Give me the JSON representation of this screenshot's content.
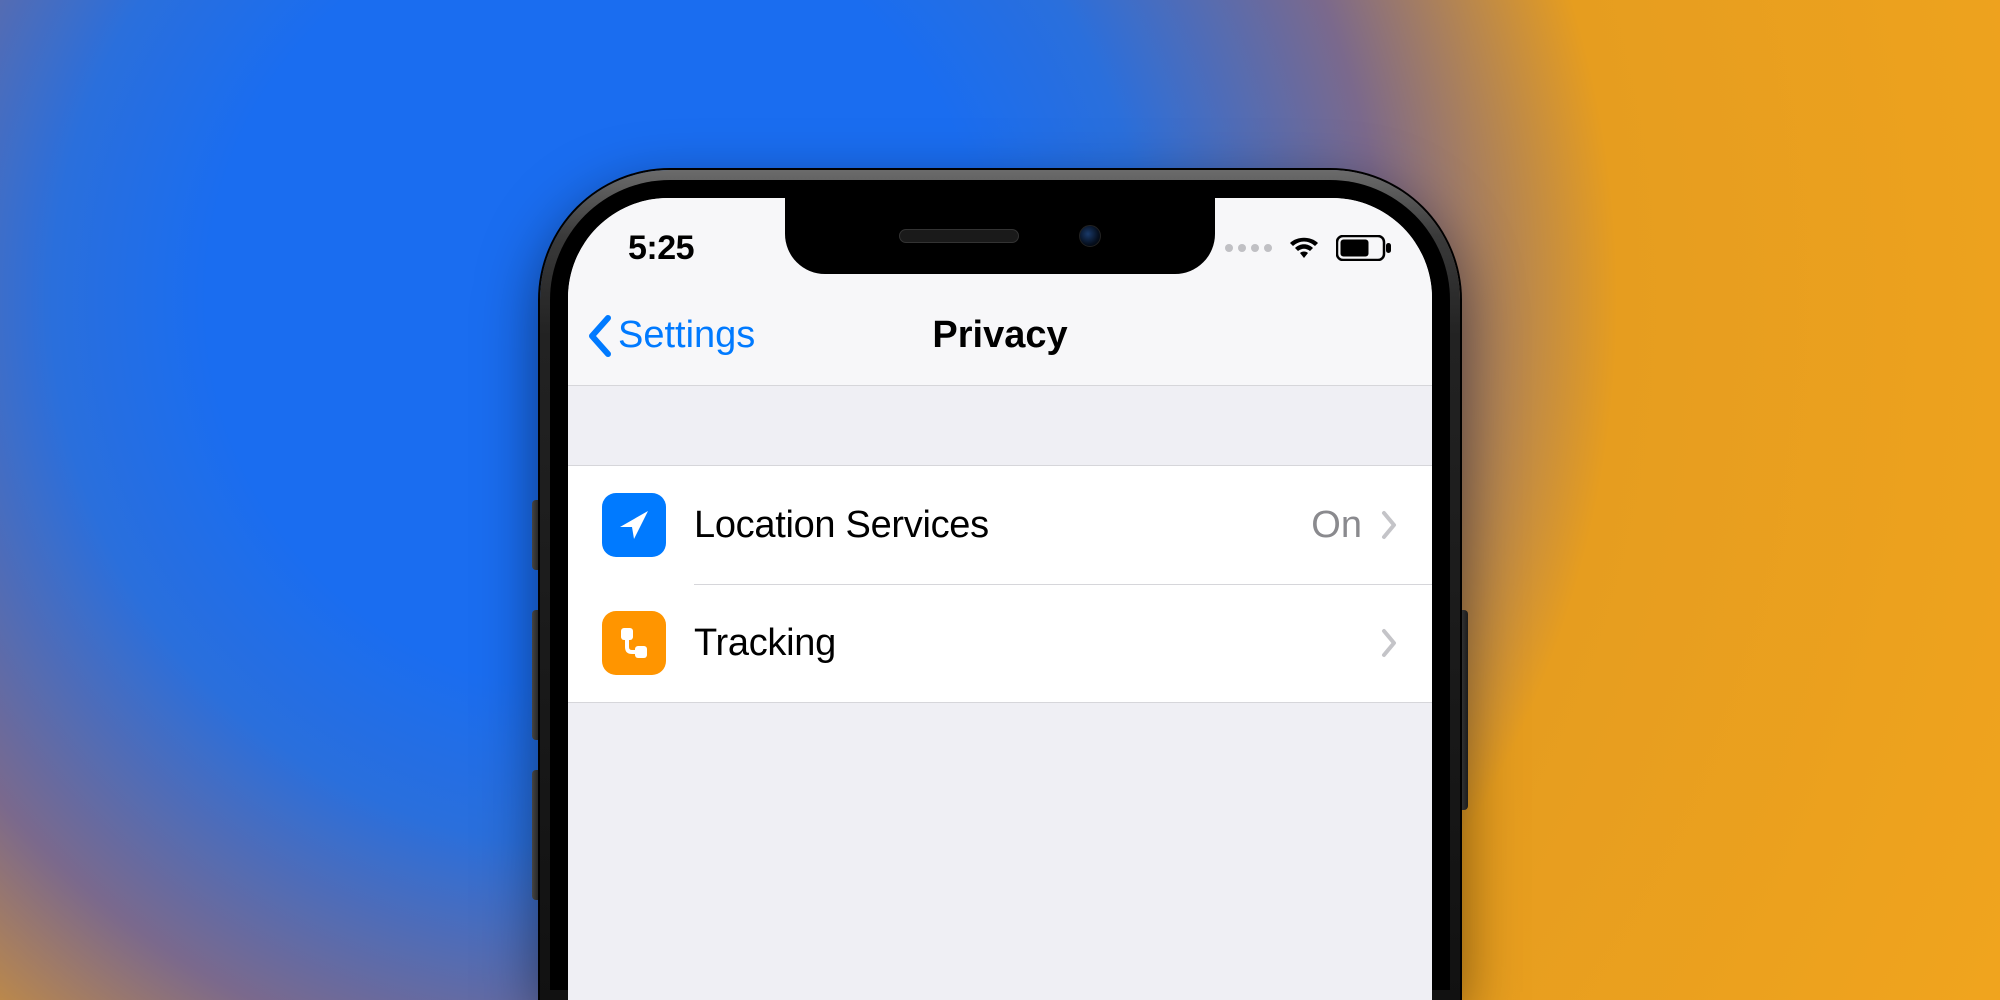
{
  "statusBar": {
    "time": "5:25"
  },
  "nav": {
    "back_label": "Settings",
    "title": "Privacy"
  },
  "rows": [
    {
      "label": "Location Services",
      "value": "On"
    },
    {
      "label": "Tracking",
      "value": ""
    }
  ],
  "colors": {
    "ios_blue": "#007aff",
    "ios_orange": "#ff9500",
    "ios_gray": "#8a8a8e"
  }
}
